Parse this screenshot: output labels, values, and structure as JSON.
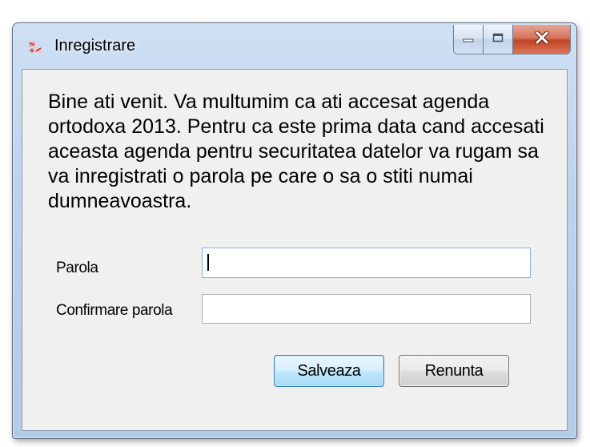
{
  "window": {
    "title": "Inregistrare",
    "icon": "app-icon",
    "controls": [
      "minimize-icon",
      "maximize-icon",
      "close-icon"
    ]
  },
  "intro_text": "Bine ati venit.  Va multumim ca ati accesat agenda ortodoxa 2013. Pentru ca este prima data cand accesati aceasta agenda pentru securitatea datelor va rugam sa va inregistrati o parola pe care o sa o stiti numai dumneavoastra.",
  "form": {
    "password_label": "Parola",
    "password_value": "",
    "confirm_label": "Confirmare parola",
    "confirm_value": ""
  },
  "buttons": {
    "save": "Salveaza",
    "cancel": "Renunta"
  },
  "colors": {
    "accent": "#3c7fb1",
    "close": "#c04425"
  }
}
